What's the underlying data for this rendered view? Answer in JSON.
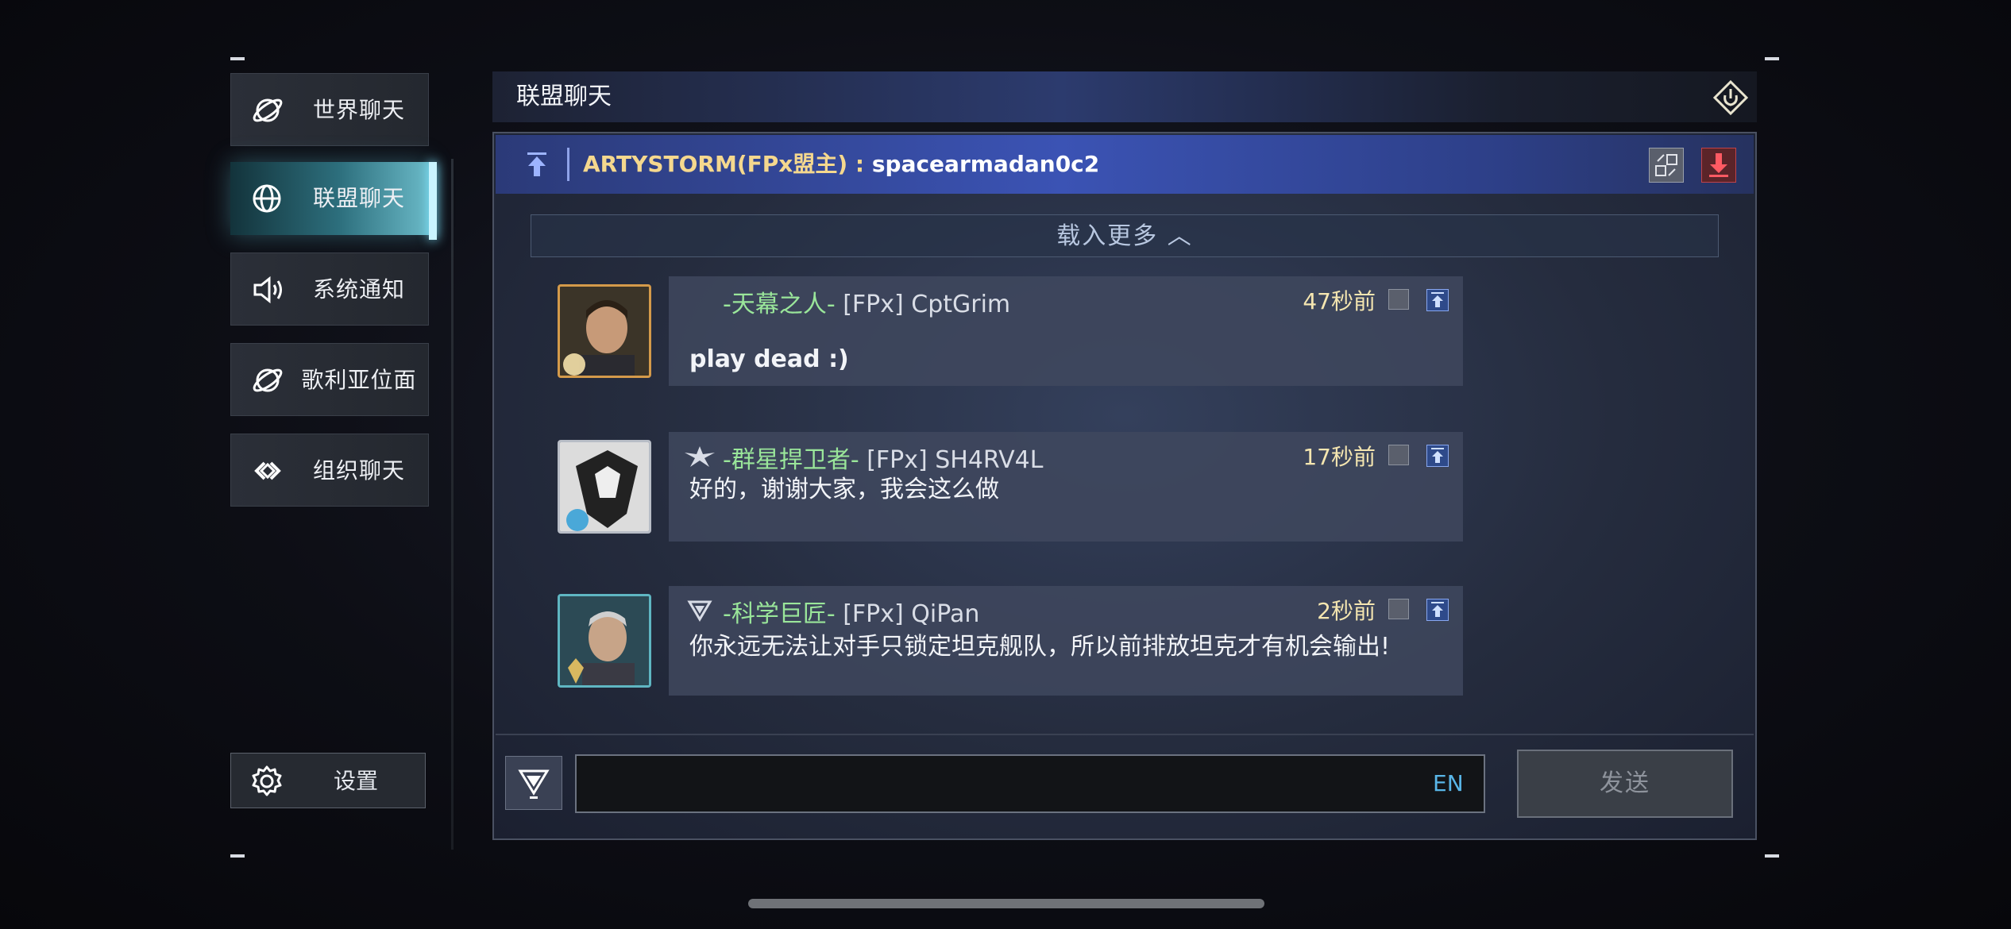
{
  "sidebar": {
    "items": [
      {
        "label": "世界聊天",
        "icon": "planet-icon",
        "active": false
      },
      {
        "label": "联盟聊天",
        "icon": "globe-icon",
        "active": true
      },
      {
        "label": "系统通知",
        "icon": "speaker-icon",
        "active": false
      },
      {
        "label": "歌利亚位面",
        "icon": "planet-icon",
        "active": false
      },
      {
        "label": "组织聊天",
        "icon": "link-icon",
        "active": false
      }
    ],
    "settings_label": "设置"
  },
  "header": {
    "title": "联盟聊天"
  },
  "pinned": {
    "author": "ARTYSTORM(FPx盟主)",
    "separator": " : ",
    "message": "spacearmadan0c2"
  },
  "load_more_label": "载入更多 ︿",
  "messages": [
    {
      "title": "-天幕之人-",
      "user": "[FPx] CptGrim",
      "time": "47秒前",
      "text": "play dead :)"
    },
    {
      "title": "-群星捍卫者-",
      "user": "[FPx] SH4RV4L",
      "time": "17秒前",
      "text": "好的，谢谢大家，我会这么做"
    },
    {
      "title": "-科学巨匠-",
      "user": "[FPx] QiPan",
      "time": "2秒前",
      "text": "你永远无法让对手只锁定坦克舰队，所以前排放坦克才有机会输出!"
    }
  ],
  "input": {
    "value": "",
    "lang": "EN",
    "send_label": "发送"
  },
  "colors": {
    "accent": "#5fc8dc",
    "pinned_author": "#f5d88e",
    "title_green": "#9ae69a",
    "time": "#f5e6b0"
  }
}
